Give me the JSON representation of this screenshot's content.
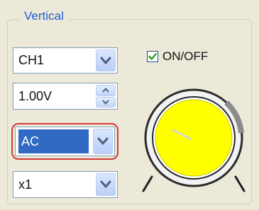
{
  "group": {
    "title": "Vertical"
  },
  "channel_select": {
    "value": "CH1",
    "icon": "chevron-down-icon"
  },
  "onoff": {
    "label": "ON/OFF",
    "checked": true,
    "icon": "checkmark-icon"
  },
  "volts_spinner": {
    "value": "1.00V",
    "icons": [
      "spin-up-icon",
      "spin-down-icon"
    ]
  },
  "coupling_select": {
    "value": "AC",
    "highlighted": true,
    "highlight_color": "#d43a3a"
  },
  "probe_select": {
    "value": "x1"
  },
  "knob": {
    "icon": "position-knob-icon",
    "fill_color": "#ffff00"
  },
  "colors": {
    "group_title": "#1f5fd6",
    "selection": "#316ac5",
    "panel_bg": "#ece9d8"
  }
}
